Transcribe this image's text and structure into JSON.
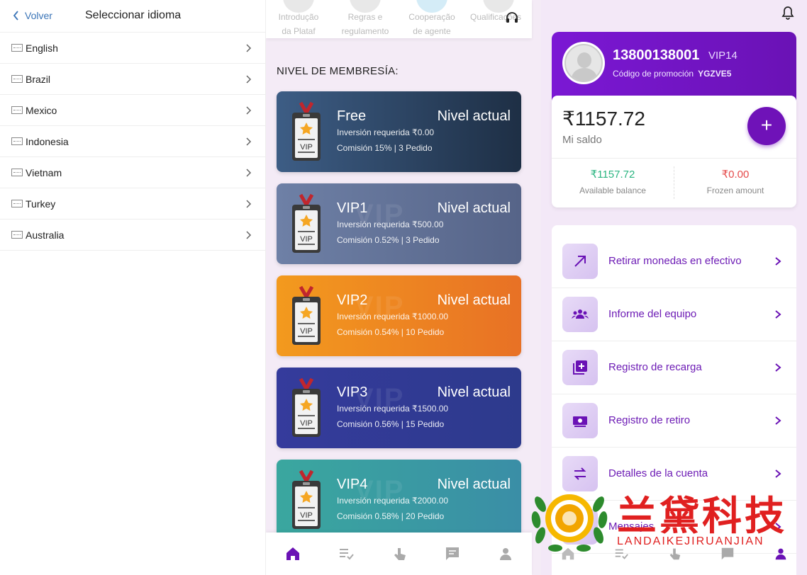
{
  "left": {
    "back_label": "Volver",
    "title": "Seleccionar idioma",
    "languages": [
      {
        "label": "English"
      },
      {
        "label": "Brazil"
      },
      {
        "label": "Mexico"
      },
      {
        "label": "Indonesia"
      },
      {
        "label": "Vietnam"
      },
      {
        "label": "Turkey"
      },
      {
        "label": "Australia"
      }
    ]
  },
  "middle": {
    "top_icons": [
      {
        "label": "Introdução\nda Plataf",
        "icon": "platform-icon"
      },
      {
        "label": "Regras e\nregulamento",
        "icon": "rules-icon"
      },
      {
        "label": "Cooperação\nde agente",
        "icon": "agent-icon"
      },
      {
        "label": "Qualificações",
        "icon": "qualification-icon"
      }
    ],
    "section_title": "NIVEL DE MEMBRESÍA:",
    "levels": [
      {
        "name": "Free",
        "status": "Nivel actual",
        "investment": "Inversión requerida ₹0.00",
        "commission": "Comisión 15% | 3 Pedido"
      },
      {
        "name": "VIP1",
        "status": "Nivel actual",
        "investment": "Inversión requerida ₹500.00",
        "commission": "Comisión 0.52% | 3 Pedido"
      },
      {
        "name": "VIP2",
        "status": "Nivel actual",
        "investment": "Inversión requerida ₹1000.00",
        "commission": "Comisión 0.54% | 10 Pedido"
      },
      {
        "name": "VIP3",
        "status": "Nivel actual",
        "investment": "Inversión requerida ₹1500.00",
        "commission": "Comisión 0.56% | 15 Pedido"
      },
      {
        "name": "VIP4",
        "status": "Nivel actual",
        "investment": "Inversión requerida ₹2000.00",
        "commission": "Comisión 0.58% | 20 Pedido"
      }
    ],
    "badge_text": "VIP",
    "watermark_text": "VIP"
  },
  "right": {
    "phone": "13800138001",
    "vip_level": "VIP14",
    "promo_label": "Código de promoción",
    "promo_code": "YGZVE5",
    "balance": "₹1157.72",
    "balance_label": "Mi saldo",
    "available": "₹1157.72",
    "available_label": "Available balance",
    "frozen": "₹0.00",
    "frozen_label": "Frozen amount",
    "menu": [
      {
        "label": "Retirar monedas en efectivo",
        "icon": "withdraw-arrow-icon"
      },
      {
        "label": "Informe del equipo",
        "icon": "team-icon"
      },
      {
        "label": "Registro de recarga",
        "icon": "recharge-icon"
      },
      {
        "label": "Registro de retiro",
        "icon": "withdrawal-record-icon"
      },
      {
        "label": "Detalles de la cuenta",
        "icon": "account-details-icon"
      },
      {
        "label": "Mensajes",
        "icon": "message-icon"
      }
    ]
  },
  "watermark": {
    "title": "兰黛科技",
    "subtitle": "LANDAIKEJIRUANJIAN"
  },
  "colors": {
    "accent": "#6f12b8",
    "available": "#2bb581",
    "frozen": "#e54b4b",
    "link": "#3a74b7"
  }
}
